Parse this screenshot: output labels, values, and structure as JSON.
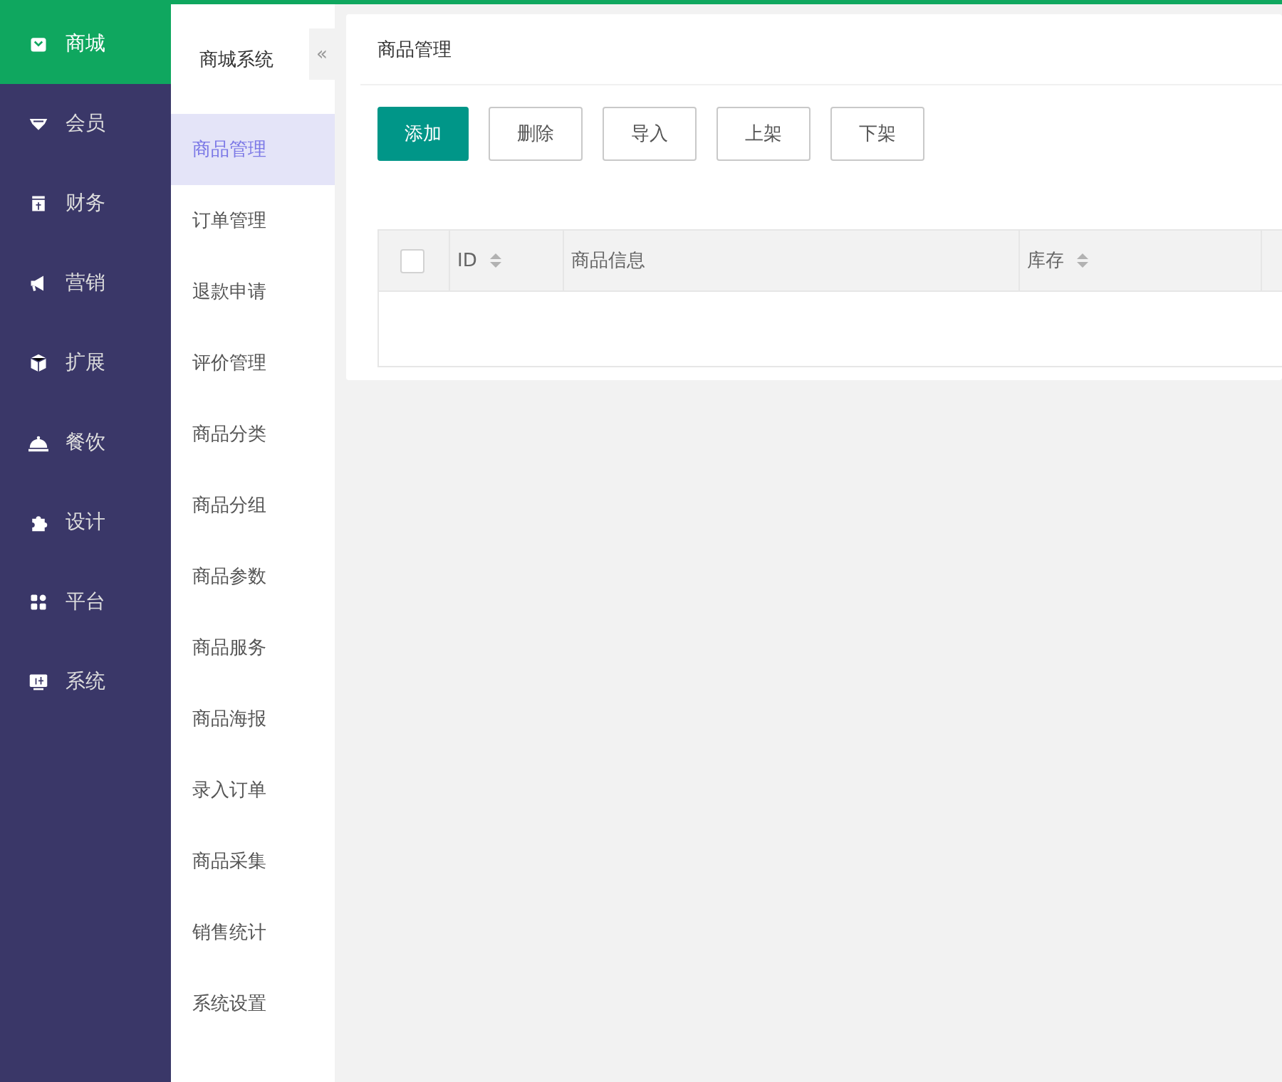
{
  "main_nav": [
    {
      "label": "商城",
      "selected": true
    },
    {
      "label": "会员",
      "selected": false
    },
    {
      "label": "财务",
      "selected": false
    },
    {
      "label": "营销",
      "selected": false
    },
    {
      "label": "扩展",
      "selected": false
    },
    {
      "label": "餐饮",
      "selected": false
    },
    {
      "label": "设计",
      "selected": false
    },
    {
      "label": "平台",
      "selected": false
    },
    {
      "label": "系统",
      "selected": false
    }
  ],
  "sub_nav": {
    "title": "商城系统",
    "collapse": "«",
    "items": [
      {
        "label": "商品管理",
        "selected": true
      },
      {
        "label": "订单管理",
        "selected": false
      },
      {
        "label": "退款申请",
        "selected": false
      },
      {
        "label": "评价管理",
        "selected": false
      },
      {
        "label": "商品分类",
        "selected": false
      },
      {
        "label": "商品分组",
        "selected": false
      },
      {
        "label": "商品参数",
        "selected": false
      },
      {
        "label": "商品服务",
        "selected": false
      },
      {
        "label": "商品海报",
        "selected": false
      },
      {
        "label": "录入订单",
        "selected": false
      },
      {
        "label": "商品采集",
        "selected": false
      },
      {
        "label": "销售统计",
        "selected": false
      },
      {
        "label": "系统设置",
        "selected": false
      }
    ]
  },
  "panel": {
    "title": "商品管理",
    "buttons": [
      {
        "label": "添加",
        "kind": "primary"
      },
      {
        "label": "删除",
        "kind": "default"
      },
      {
        "label": "导入",
        "kind": "default"
      },
      {
        "label": "上架",
        "kind": "default"
      },
      {
        "label": "下架",
        "kind": "default"
      }
    ],
    "table": {
      "select_all": {
        "checked": false
      },
      "columns": [
        {
          "label": "ID",
          "sortable": true
        },
        {
          "label": "商品信息",
          "sortable": false
        },
        {
          "label": "库存",
          "sortable": true
        }
      ]
    }
  }
}
